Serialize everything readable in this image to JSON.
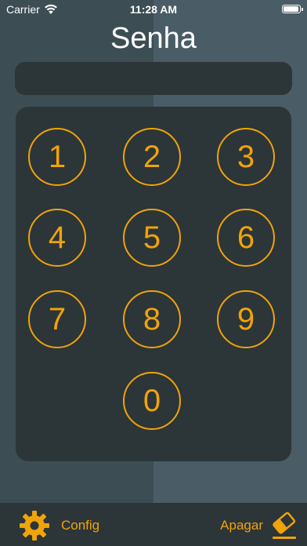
{
  "status_bar": {
    "carrier": "Carrier",
    "time": "11:28 AM",
    "icons": [
      "wifi-icon",
      "battery-icon"
    ]
  },
  "header": {
    "title": "Senha"
  },
  "password_field": {
    "value": "",
    "placeholder": ""
  },
  "keypad": {
    "keys": [
      "1",
      "2",
      "3",
      "4",
      "5",
      "6",
      "7",
      "8",
      "9",
      "0"
    ]
  },
  "bottom_bar": {
    "config_label": "Config",
    "config_icon": "gear-icon",
    "apagar_label": "Apagar",
    "apagar_icon": "eraser-icon"
  },
  "colors": {
    "accent": "#f0a30a",
    "background_left": "#3c4d54",
    "background_right": "#4a5c66",
    "panel": "#2c3538",
    "text": "#ffffff"
  }
}
